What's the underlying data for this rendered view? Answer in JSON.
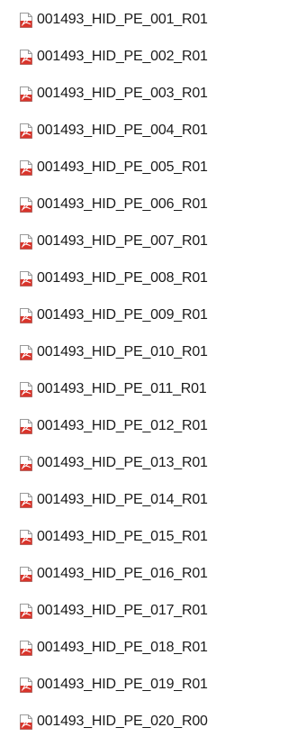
{
  "files": [
    {
      "name": "001493_HID_PE_001_R01",
      "icon": "pdf-file-icon"
    },
    {
      "name": "001493_HID_PE_002_R01",
      "icon": "pdf-file-icon"
    },
    {
      "name": "001493_HID_PE_003_R01",
      "icon": "pdf-file-icon"
    },
    {
      "name": "001493_HID_PE_004_R01",
      "icon": "pdf-file-icon"
    },
    {
      "name": "001493_HID_PE_005_R01",
      "icon": "pdf-file-icon"
    },
    {
      "name": "001493_HID_PE_006_R01",
      "icon": "pdf-file-icon"
    },
    {
      "name": "001493_HID_PE_007_R01",
      "icon": "pdf-file-icon"
    },
    {
      "name": "001493_HID_PE_008_R01",
      "icon": "pdf-file-icon"
    },
    {
      "name": "001493_HID_PE_009_R01",
      "icon": "pdf-file-icon"
    },
    {
      "name": "001493_HID_PE_010_R01",
      "icon": "pdf-file-icon"
    },
    {
      "name": "001493_HID_PE_011_R01",
      "icon": "pdf-file-icon"
    },
    {
      "name": "001493_HID_PE_012_R01",
      "icon": "pdf-file-icon"
    },
    {
      "name": "001493_HID_PE_013_R01",
      "icon": "pdf-file-icon"
    },
    {
      "name": "001493_HID_PE_014_R01",
      "icon": "pdf-file-icon"
    },
    {
      "name": "001493_HID_PE_015_R01",
      "icon": "pdf-file-icon"
    },
    {
      "name": "001493_HID_PE_016_R01",
      "icon": "pdf-file-icon"
    },
    {
      "name": "001493_HID_PE_017_R01",
      "icon": "pdf-file-icon"
    },
    {
      "name": "001493_HID_PE_018_R01",
      "icon": "pdf-file-icon"
    },
    {
      "name": "001493_HID_PE_019_R01",
      "icon": "pdf-file-icon"
    },
    {
      "name": "001493_HID_PE_020_R00",
      "icon": "pdf-file-icon"
    }
  ],
  "colors": {
    "icon_red": "#d9342b",
    "icon_page": "#ffffff",
    "icon_border": "#9a9a9a",
    "text": "#1a1a1a"
  }
}
